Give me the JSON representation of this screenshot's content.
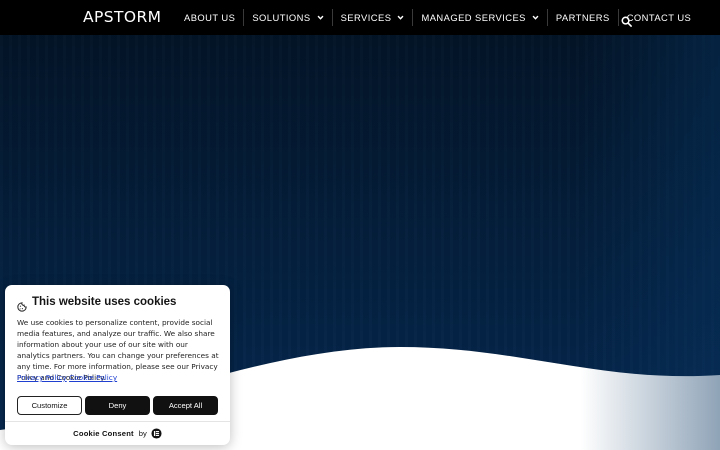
{
  "header": {
    "logo": "APSTORM",
    "nav": [
      {
        "label": "ABOUT US",
        "dropdown": false
      },
      {
        "label": "SOLUTIONS",
        "dropdown": true
      },
      {
        "label": "SERVICES",
        "dropdown": true
      },
      {
        "label": "MANAGED SERVICES",
        "dropdown": true
      },
      {
        "label": "PARTNERS",
        "dropdown": false
      },
      {
        "label": "CONTACT US",
        "dropdown": false
      }
    ],
    "search_icon": "search-icon"
  },
  "colors": {
    "header_bg": "#000000",
    "hero_bg": "#04203f",
    "link": "#1e3fd0",
    "button_dark": "#111111"
  },
  "cookie": {
    "icon": "cookie-icon",
    "title": "This website uses cookies",
    "body": "We use cookies to personalize content, provide social media features, and analyze our traffic. We also share information about your use of our site with our analytics partners. You can change your preferences at any time. For more information, please see our Privacy Policy and Cookie Policy.",
    "links": {
      "privacy": "Privacy Policy",
      "cookie": "Cookie Policy"
    },
    "buttons": {
      "customize": "Customize",
      "deny": "Deny",
      "accept": "Accept All"
    },
    "footer": {
      "brand": "Cookie Consent",
      "by": "by",
      "logo_icon": "cookie-consent-logo-icon"
    }
  }
}
